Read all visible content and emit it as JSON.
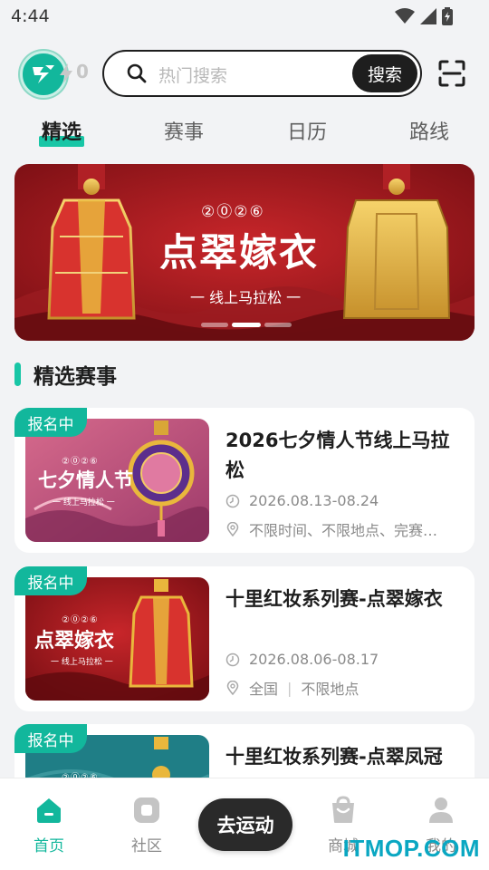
{
  "status_bar": {
    "time": "4:44"
  },
  "header": {
    "energy_count": "0",
    "search_placeholder": "热门搜索",
    "search_button": "搜索"
  },
  "tabs": [
    {
      "label": "精选",
      "active": true
    },
    {
      "label": "赛事",
      "active": false
    },
    {
      "label": "日历",
      "active": false
    },
    {
      "label": "路线",
      "active": false
    }
  ],
  "banner": {
    "year": "②⓪②⑥",
    "title": "点翠嫁衣",
    "subtitle": "一 线上马拉松 一",
    "slide_count": 3,
    "active_slide": 2
  },
  "section": {
    "title": "精选赛事"
  },
  "events": [
    {
      "badge": "报名中",
      "title": "2026七夕情人节线上马拉松",
      "date": "2026.08.13-08.24",
      "location": "不限时间、不限地点、完赛…",
      "image": {
        "year": "②⓪②⑥",
        "title": "七夕情人节",
        "subtitle": "一 线上马拉松 一"
      }
    },
    {
      "badge": "报名中",
      "title": "十里红妆系列赛-点翠嫁衣",
      "date": "2026.08.06-08.17",
      "location": "全国",
      "location_extra": "不限地点",
      "image": {
        "year": "②⓪②⑥",
        "title": "点翠嫁衣",
        "subtitle": "一 线上马拉松 一"
      }
    },
    {
      "badge": "报名中",
      "title": "十里红妆系列赛-点翠凤冠",
      "image": {
        "year": "②⓪②⑥"
      }
    }
  ],
  "tabbar": {
    "home": "首页",
    "community": "社区",
    "go": "去运动",
    "mall": "商城",
    "mine": "我的"
  },
  "watermark": "ITMOP.COM",
  "colors": {
    "accent": "#12b79c",
    "dark": "#1e1e1e",
    "banner_red": "#a3191c",
    "gold": "#e9b73c"
  }
}
